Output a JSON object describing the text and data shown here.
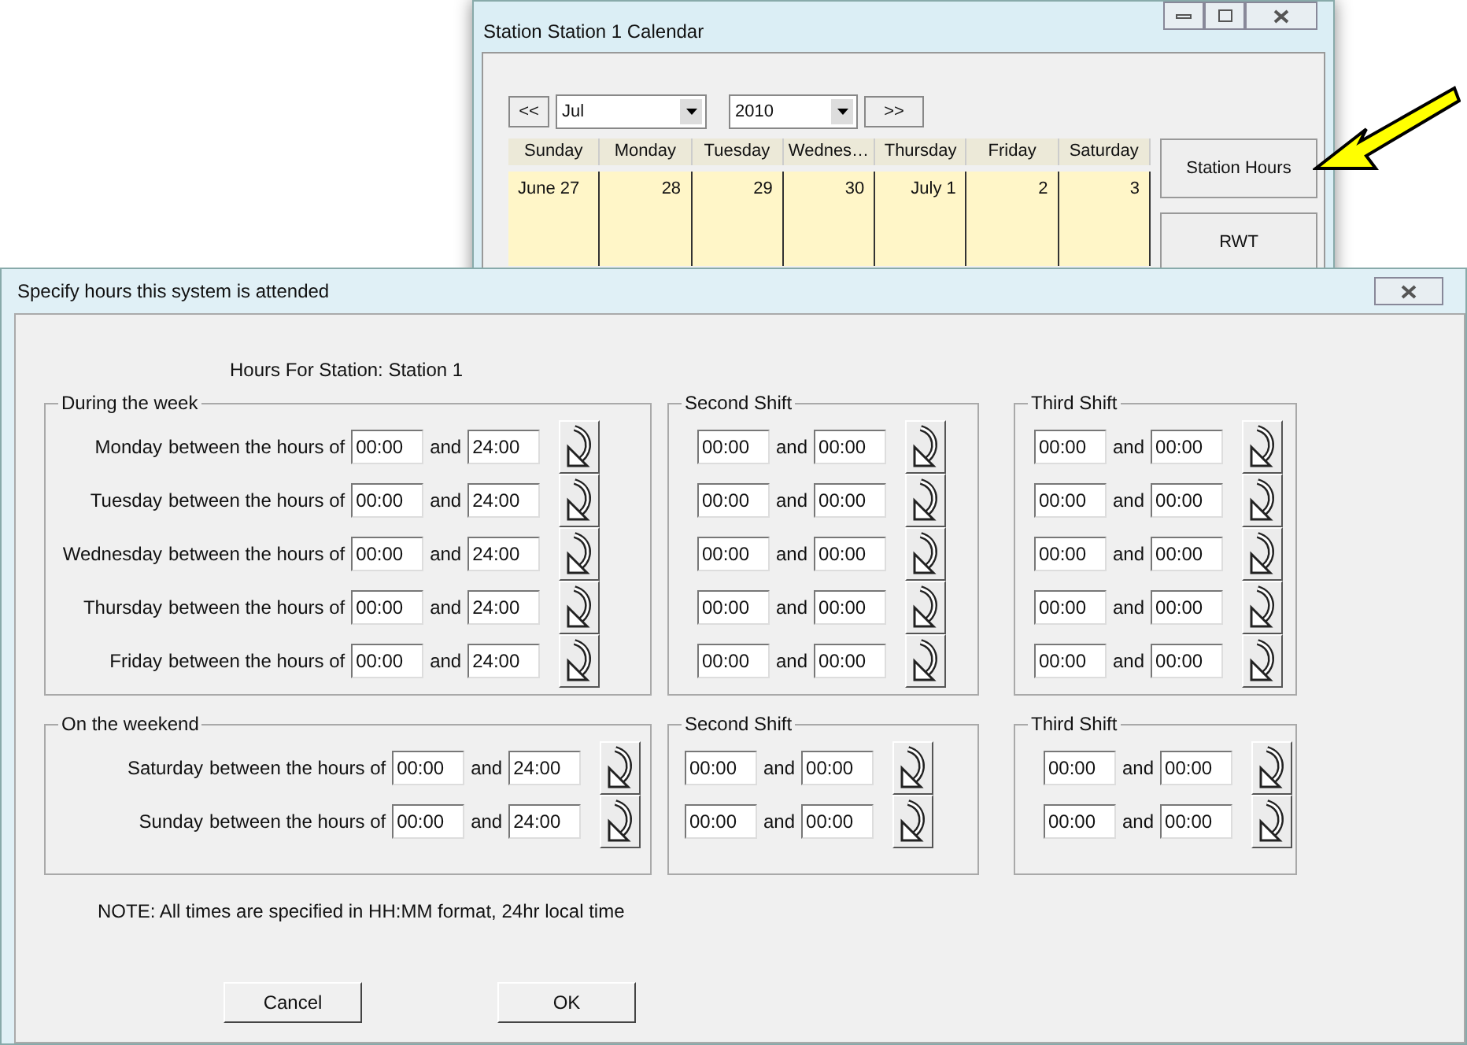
{
  "calendar_window": {
    "title": "Station Station 1 Calendar",
    "prev": "<<",
    "month": "Jul",
    "year": "2010",
    "next": ">>",
    "days": [
      "Sunday",
      "Monday",
      "Tuesday",
      "Wednes…",
      "Thursday",
      "Friday",
      "Saturday"
    ],
    "dates": [
      "June 27",
      "28",
      "29",
      "30",
      "July 1",
      "2",
      "3"
    ],
    "buttons": [
      "Station Hours",
      "RWT"
    ]
  },
  "dialog": {
    "title": "Specify hours this system is attended",
    "heading": "Hours For Station: Station 1",
    "weekday": {
      "label": "During the week",
      "rows": [
        {
          "day": "Monday",
          "text": "between the hours of",
          "start": "00:00",
          "and": "and",
          "end": "24:00"
        },
        {
          "day": "Tuesday",
          "text": "between the hours of",
          "start": "00:00",
          "and": "and",
          "end": "24:00"
        },
        {
          "day": "Wednesday",
          "text": "between the hours of",
          "start": "00:00",
          "and": "and",
          "end": "24:00"
        },
        {
          "day": "Thursday",
          "text": "between the hours of",
          "start": "00:00",
          "and": "and",
          "end": "24:00"
        },
        {
          "day": "Friday",
          "text": "between the hours of",
          "start": "00:00",
          "and": "and",
          "end": "24:00"
        }
      ]
    },
    "weekday_second_shift": {
      "label": "Second Shift",
      "rows": [
        {
          "start": "00:00",
          "and": "and",
          "end": "00:00"
        },
        {
          "start": "00:00",
          "and": "and",
          "end": "00:00"
        },
        {
          "start": "00:00",
          "and": "and",
          "end": "00:00"
        },
        {
          "start": "00:00",
          "and": "and",
          "end": "00:00"
        },
        {
          "start": "00:00",
          "and": "and",
          "end": "00:00"
        }
      ]
    },
    "weekday_third_shift": {
      "label": "Third Shift",
      "rows": [
        {
          "start": "00:00",
          "and": "and",
          "end": "00:00"
        },
        {
          "start": "00:00",
          "and": "and",
          "end": "00:00"
        },
        {
          "start": "00:00",
          "and": "and",
          "end": "00:00"
        },
        {
          "start": "00:00",
          "and": "and",
          "end": "00:00"
        },
        {
          "start": "00:00",
          "and": "and",
          "end": "00:00"
        }
      ]
    },
    "weekend": {
      "label": "On the weekend",
      "rows": [
        {
          "day": "Saturday",
          "text": "between the hours of",
          "start": "00:00",
          "and": "and",
          "end": "24:00"
        },
        {
          "day": "Sunday",
          "text": "between the hours of",
          "start": "00:00",
          "and": "and",
          "end": "24:00"
        }
      ]
    },
    "weekend_second_shift": {
      "label": "Second Shift",
      "rows": [
        {
          "start": "00:00",
          "and": "and",
          "end": "00:00"
        },
        {
          "start": "00:00",
          "and": "and",
          "end": "00:00"
        }
      ]
    },
    "weekend_third_shift": {
      "label": "Third Shift",
      "rows": [
        {
          "start": "00:00",
          "and": "and",
          "end": "00:00"
        },
        {
          "start": "00:00",
          "and": "and",
          "end": "00:00"
        }
      ]
    },
    "note": "NOTE: All times are specified in HH:MM format, 24hr local time",
    "buttons": [
      "Cancel",
      "OK"
    ]
  }
}
